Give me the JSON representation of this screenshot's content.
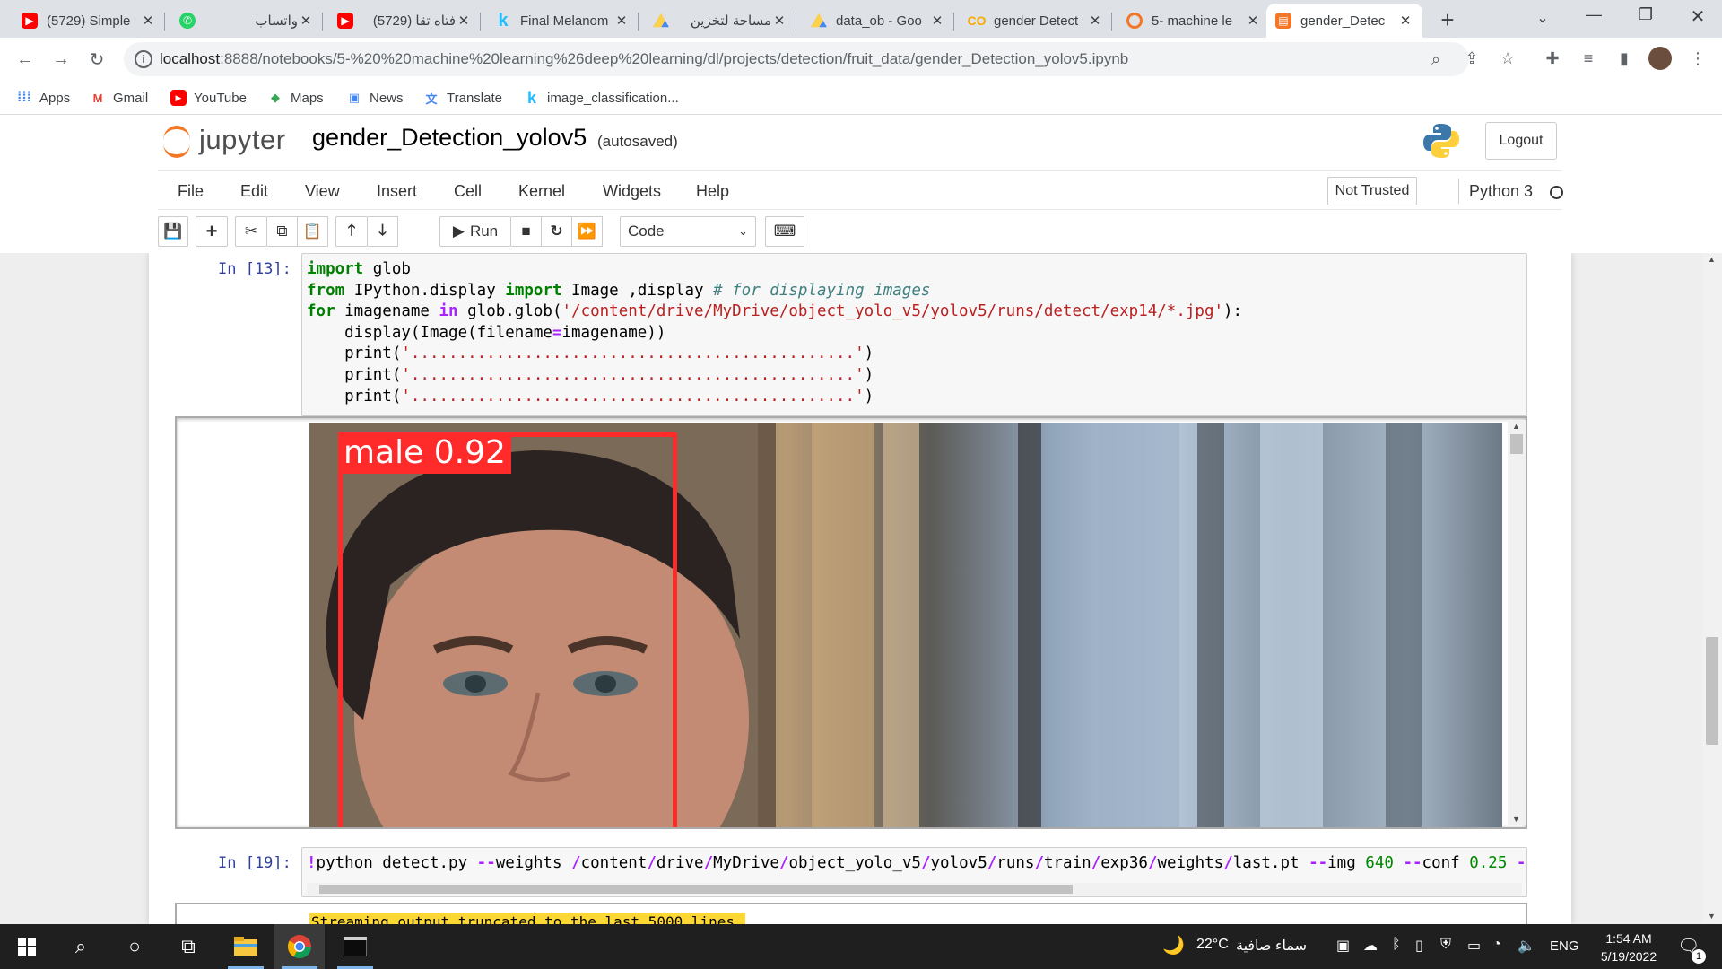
{
  "browser": {
    "tabs": [
      {
        "title": "(5729) Simple",
        "icon": "youtube-icon"
      },
      {
        "title": "واتساب",
        "icon": "whatsapp-icon"
      },
      {
        "title": "(5729) فتاه تقا",
        "icon": "youtube-icon"
      },
      {
        "title": "Final Melanom",
        "icon": "kaggle-icon"
      },
      {
        "title": "مساحة لتخزين",
        "icon": "google-drive-icon"
      },
      {
        "title": "data_ob - Goo",
        "icon": "google-drive-icon"
      },
      {
        "title": "gender Detect",
        "icon": "colab-icon"
      },
      {
        "title": "5- machine le",
        "icon": "jupyter-icon"
      },
      {
        "title": "gender_Detec",
        "icon": "notebook-icon"
      }
    ],
    "active_tab": 8,
    "url_host": "localhost",
    "url_path": ":8888/notebooks/5-%20%20machine%20learning%26deep%20learning/dl/projects/detection/fruit_data/gender_Detection_yolov5.ipynb",
    "bookmarks": [
      {
        "label": "Apps",
        "icon": "apps-grid-icon"
      },
      {
        "label": "Gmail",
        "icon": "gmail-icon"
      },
      {
        "label": "YouTube",
        "icon": "youtube-icon"
      },
      {
        "label": "Maps",
        "icon": "maps-icon"
      },
      {
        "label": "News",
        "icon": "news-icon"
      },
      {
        "label": "Translate",
        "icon": "translate-icon"
      },
      {
        "label": "image_classification...",
        "icon": "kaggle-icon"
      }
    ]
  },
  "jupyter": {
    "logo_text": "jupyter",
    "notebook_name": "gender_Detection_yolov5",
    "autosave_status": "(autosaved)",
    "logout_label": "Logout",
    "menus": [
      "File",
      "Edit",
      "View",
      "Insert",
      "Cell",
      "Kernel",
      "Widgets",
      "Help"
    ],
    "trust_label": "Not Trusted",
    "kernel_name": "Python 3",
    "run_label": "Run",
    "cell_type": "Code"
  },
  "cells": [
    {
      "prompt": "In [13]:",
      "code_lines": [
        "import glob",
        "from IPython.display import Image ,display # for displaying images",
        "for imagename in glob.glob('/content/drive/MyDrive/object_yolo_v5/yolov5/runs/detect/exp14/*.jpg'):",
        "    display(Image(filename=imagename))",
        "    print('...............................................')",
        "    print('...............................................')",
        "    print('...............................................')"
      ],
      "output": {
        "detection_label": "male 0.92",
        "box_color": "#ff2a2a"
      }
    },
    {
      "prompt": "In [19]:",
      "code_lines": [
        "!python detect.py --weights /content/drive/MyDrive/object_yolo_v5/yolov5/runs/train/exp36/weights/last.pt --img 640 --conf 0.25 -"
      ],
      "output_text": "Streaming output truncated to the last 5000 lines."
    }
  ],
  "taskbar": {
    "weather_temp": "22°C",
    "weather_text": "سماء صافية",
    "language": "ENG",
    "time": "1:54 AM",
    "date": "5/19/2022",
    "notification_count": "1"
  },
  "colors": {
    "jupyter_orange": "#f37726",
    "prompt_blue": "#303f9f",
    "highlight_yellow": "#fdd835"
  }
}
